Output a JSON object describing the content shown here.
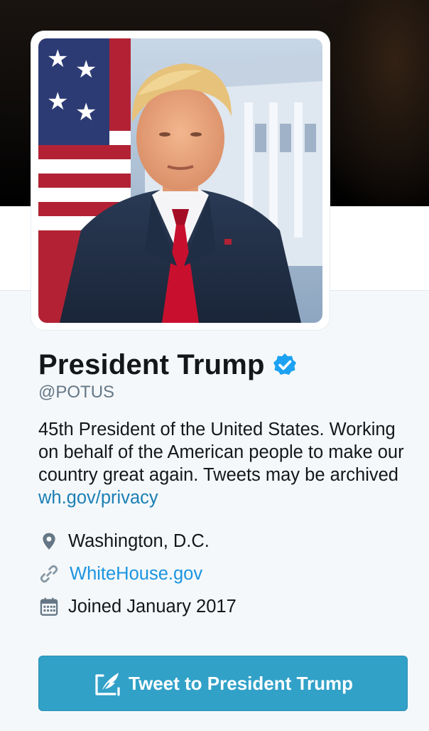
{
  "profile": {
    "name": "President Trump",
    "screen_name": "@POTUS",
    "avatar_alt": "avatar-portrait",
    "verified": true,
    "bio_text": "45th President of the United States. Working on behalf of the American people to make our country great again. Tweets may be archived ",
    "bio_link": "wh.gov/privacy",
    "location": "Washington, D.C.",
    "website": "WhiteHouse.gov",
    "joined": "Joined January 2017"
  },
  "actions": {
    "tweet_to_label": "Tweet to President Trump"
  },
  "icons": {
    "verified": "verified-badge-icon",
    "location": "map-pin-icon",
    "website": "link-icon",
    "joined": "calendar-icon",
    "tweet": "compose-quill-icon"
  },
  "colors": {
    "verified": "#1da1f2",
    "link": "#1b95e0",
    "button": "#31a1c8",
    "text": "#14171a",
    "muted": "#657786"
  }
}
